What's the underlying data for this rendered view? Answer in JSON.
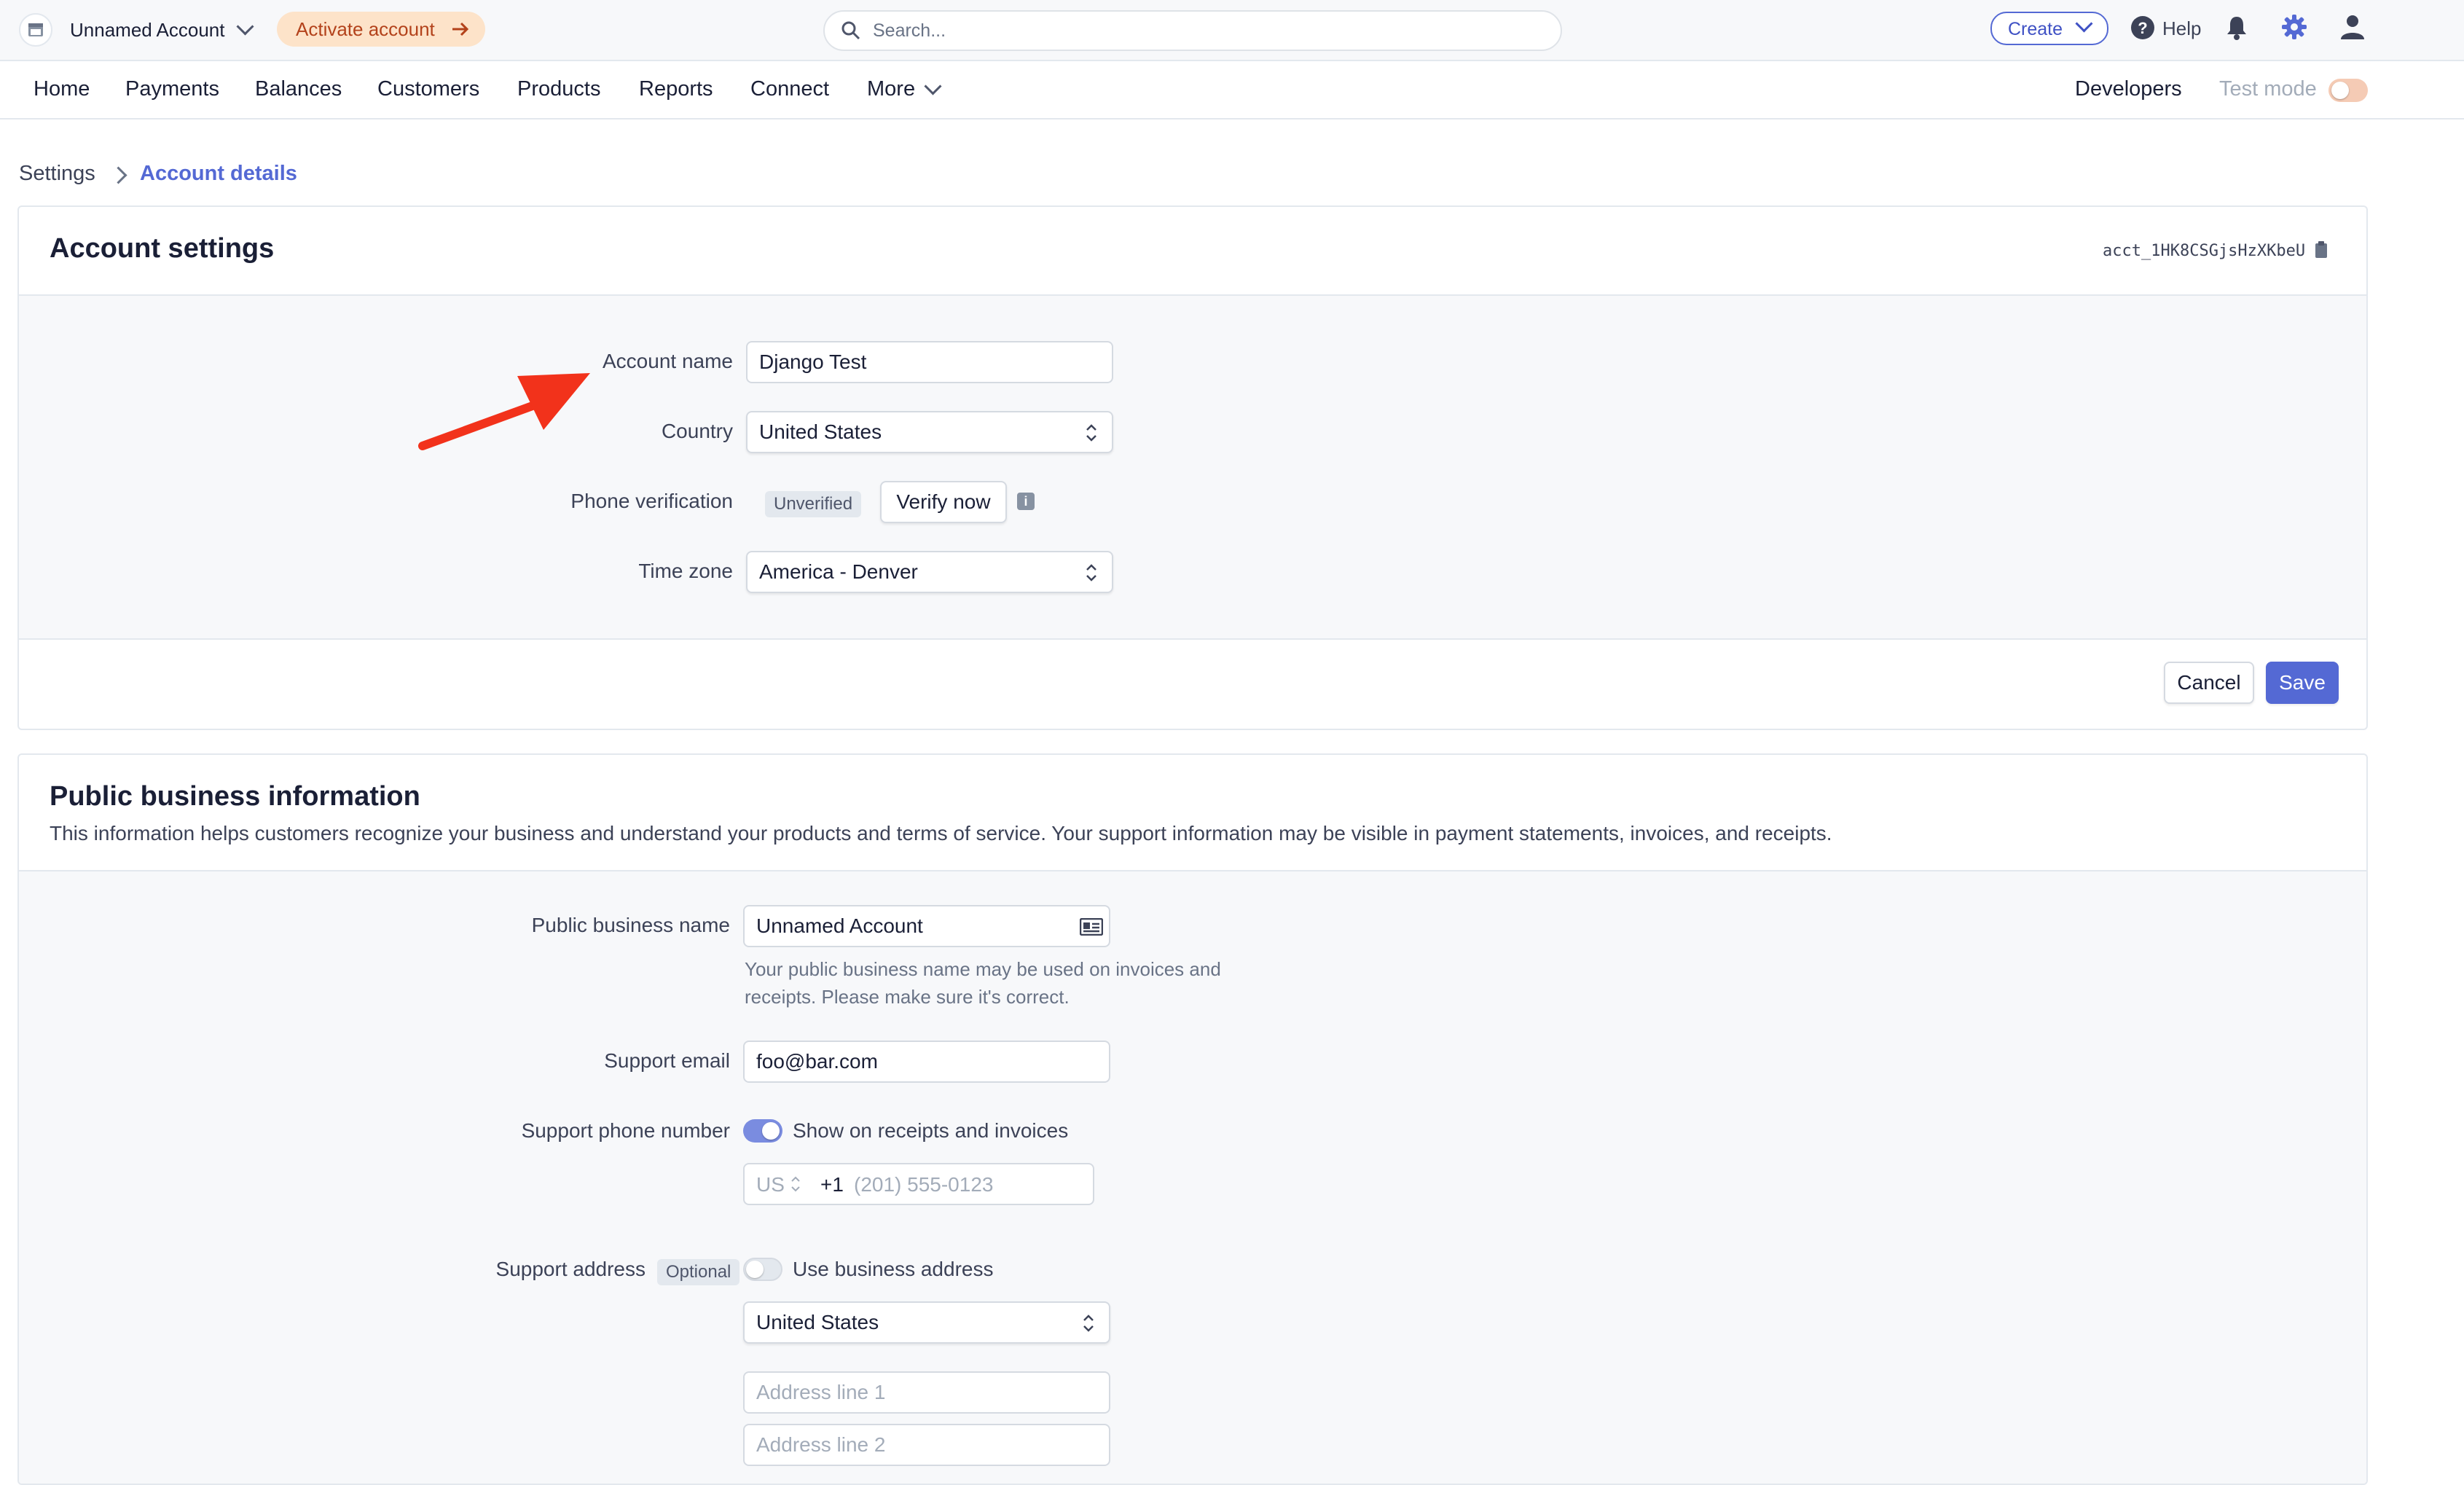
{
  "topbar": {
    "account_name": "Unnamed Account",
    "activate_label": "Activate account",
    "search_placeholder": "Search...",
    "create_label": "Create",
    "help_label": "Help"
  },
  "nav": {
    "items": [
      "Home",
      "Payments",
      "Balances",
      "Customers",
      "Products",
      "Reports",
      "Connect",
      "More"
    ],
    "developers_label": "Developers",
    "test_mode_label": "Test mode"
  },
  "breadcrumb": {
    "parent": "Settings",
    "current": "Account details"
  },
  "account_settings": {
    "title": "Account settings",
    "account_id": "acct_1HK8CSGjsHzXKbeU",
    "account_name_label": "Account name",
    "account_name_value": "Django Test",
    "country_label": "Country",
    "country_value": "United States",
    "phone_label": "Phone verification",
    "phone_badge": "Unverified",
    "verify_label": "Verify now",
    "timezone_label": "Time zone",
    "timezone_value": "America - Denver",
    "cancel_label": "Cancel",
    "save_label": "Save"
  },
  "public_info": {
    "title": "Public business information",
    "description": "This information helps customers recognize your business and understand your products and terms of service. Your support information may be visible in payment statements, invoices, and receipts.",
    "business_name_label": "Public business name",
    "business_name_value": "Unnamed Account",
    "business_name_help_1": "Your public business name may be used on invoices and",
    "business_name_help_2": "receipts. Please make sure it's correct.",
    "support_email_label": "Support email",
    "support_email_value": "foo@bar.com",
    "support_phone_label": "Support phone number",
    "show_on_receipts_label": "Show on receipts and invoices",
    "show_on_receipts_enabled": true,
    "phone_country": "US",
    "phone_code": "+1",
    "phone_placeholder": "(201) 555-0123",
    "support_address_label": "Support address",
    "optional_badge": "Optional",
    "use_business_address_label": "Use business address",
    "use_business_address_enabled": false,
    "address_country_value": "United States",
    "address_line1_placeholder": "Address line 1",
    "address_line2_placeholder": "Address line 2"
  },
  "colors": {
    "accent": "#5469d4",
    "annotation_arrow": "#f2321b",
    "orange_pill": "#fde3c9"
  }
}
